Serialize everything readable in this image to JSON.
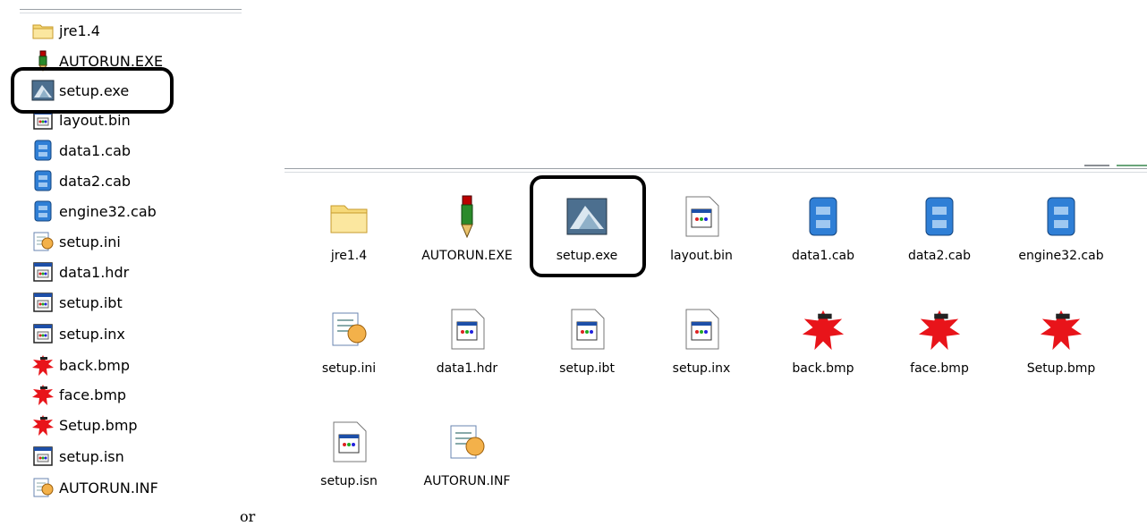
{
  "list_view": {
    "items": [
      {
        "label": "jre1.4",
        "icon": "folder-icon"
      },
      {
        "label": "AUTORUN.EXE",
        "icon": "autorun-exe-icon"
      },
      {
        "label": "setup.exe",
        "icon": "installshield-setup-icon",
        "highlighted": true
      },
      {
        "label": "layout.bin",
        "icon": "generic-file-icon"
      },
      {
        "label": "data1.cab",
        "icon": "cabinet-file-icon"
      },
      {
        "label": "data2.cab",
        "icon": "cabinet-file-icon"
      },
      {
        "label": "engine32.cab",
        "icon": "cabinet-file-icon"
      },
      {
        "label": "setup.ini",
        "icon": "ini-settings-icon"
      },
      {
        "label": "data1.hdr",
        "icon": "generic-file-icon"
      },
      {
        "label": "setup.ibt",
        "icon": "generic-file-icon"
      },
      {
        "label": "setup.inx",
        "icon": "generic-file-icon"
      },
      {
        "label": "back.bmp",
        "icon": "bitmap-paint-icon"
      },
      {
        "label": "face.bmp",
        "icon": "bitmap-paint-icon"
      },
      {
        "label": "Setup.bmp",
        "icon": "bitmap-paint-icon"
      },
      {
        "label": "setup.isn",
        "icon": "generic-file-icon"
      },
      {
        "label": "AUTORUN.INF",
        "icon": "ini-settings-icon"
      }
    ]
  },
  "icon_view": {
    "items": [
      {
        "label": "jre1.4",
        "icon": "folder-icon"
      },
      {
        "label": "AUTORUN.EXE",
        "icon": "autorun-exe-icon"
      },
      {
        "label": "setup.exe",
        "icon": "installshield-setup-icon",
        "highlighted": true
      },
      {
        "label": "layout.bin",
        "icon": "generic-file-icon"
      },
      {
        "label": "data1.cab",
        "icon": "cabinet-file-icon"
      },
      {
        "label": "data2.cab",
        "icon": "cabinet-file-icon"
      },
      {
        "label": "engine32.cab",
        "icon": "cabinet-file-icon"
      },
      {
        "label": "setup.ini",
        "icon": "ini-settings-icon"
      },
      {
        "label": "data1.hdr",
        "icon": "generic-file-icon"
      },
      {
        "label": "setup.ibt",
        "icon": "generic-file-icon"
      },
      {
        "label": "setup.inx",
        "icon": "generic-file-icon"
      },
      {
        "label": "back.bmp",
        "icon": "bitmap-paint-icon"
      },
      {
        "label": "face.bmp",
        "icon": "bitmap-paint-icon"
      },
      {
        "label": "Setup.bmp",
        "icon": "bitmap-paint-icon"
      },
      {
        "label": "setup.isn",
        "icon": "generic-file-icon"
      },
      {
        "label": "AUTORUN.INF",
        "icon": "ini-settings-icon"
      }
    ]
  },
  "separator_text": "or",
  "colors": {
    "folder": "#f6d979",
    "cab": "#2f7fd6",
    "paint": "#e8141a",
    "highlight_border": "#000000"
  }
}
